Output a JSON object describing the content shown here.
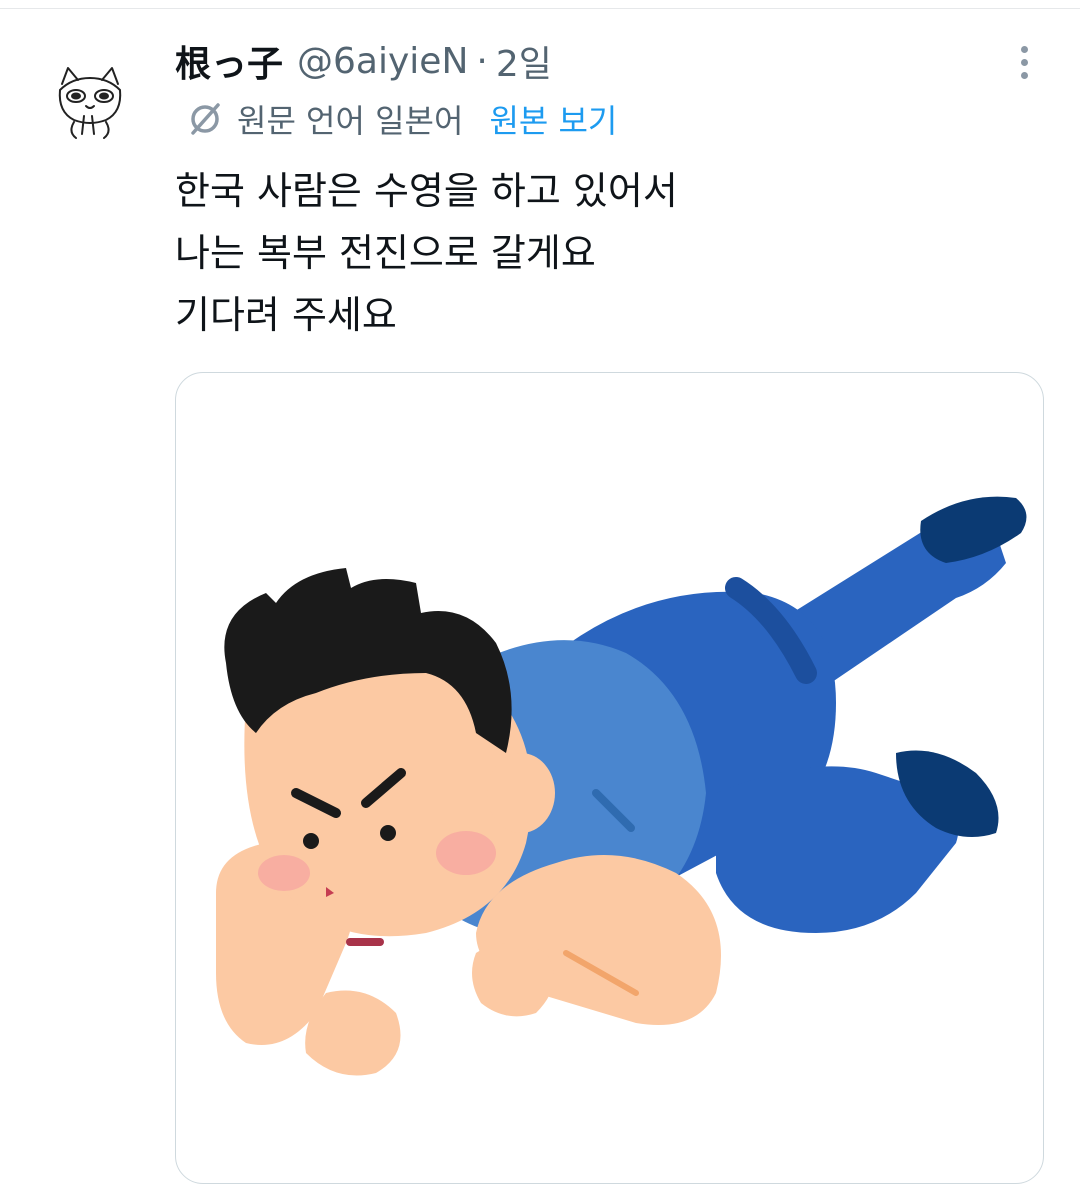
{
  "tweet": {
    "author": {
      "display_name": "根っ子",
      "handle": "@6aiyieN",
      "avatar_icon": "sketch-cat-avatar-icon"
    },
    "separator": "·",
    "timestamp": "2일",
    "translation": {
      "notice": "원문 언어 일본어",
      "view_original": "원본 보기",
      "icon": "translate-slash-icon"
    },
    "text_lines": [
      "한국 사람은 수영을 하고 있어서",
      "나는 복부 전진으로 갈게요",
      "기다려 주세요"
    ],
    "more_icon": "more-vertical-icon",
    "media": {
      "type": "illustration",
      "subject": "crawling-man-illustration",
      "colors": {
        "shirt": "#4a86cf",
        "pants": "#2a64bf",
        "shoes": "#0b3a73",
        "skin": "#fcc9a3",
        "hair": "#1a1a1a"
      }
    }
  },
  "colors": {
    "text_primary": "#0f1419",
    "text_secondary": "#536471",
    "link": "#1d9bf0",
    "border": "#cfd9de"
  }
}
